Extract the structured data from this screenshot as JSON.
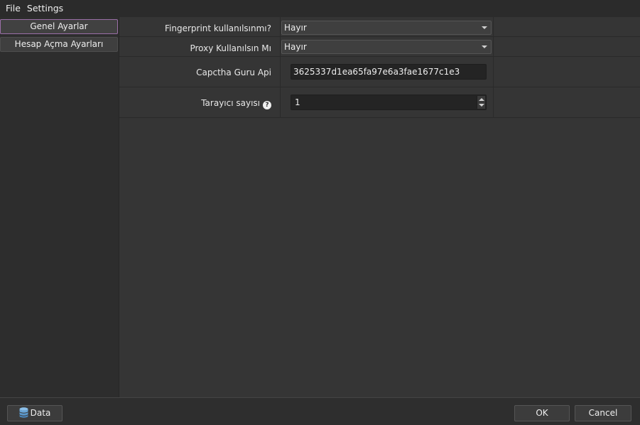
{
  "menubar": {
    "file": "File",
    "settings": "Settings"
  },
  "sidebar": {
    "items": [
      {
        "label": "Genel Ayarlar",
        "active": true
      },
      {
        "label": "Hesap Açma Ayarları",
        "active": false
      }
    ]
  },
  "settings": {
    "fingerprint": {
      "label": "Fingerprint kullanılsınmı?",
      "value": "Hayır"
    },
    "proxy": {
      "label": "Proxy Kullanılsın Mı",
      "value": "Hayır"
    },
    "captcha": {
      "label": "Capctha Guru Api",
      "value": "3625337d1ea65fa97e6a3fae1677c1e3"
    },
    "browsers": {
      "label": "Tarayıcı sayısı",
      "value": "1",
      "help_icon": "question-circle-icon"
    }
  },
  "footer": {
    "data_label": "Data",
    "data_icon": "database-icon",
    "ok_label": "OK",
    "cancel_label": "Cancel"
  },
  "colors": {
    "background": "#303030",
    "active_border": "#9a6fa7",
    "field_dark": "#242424",
    "db_icon": "#6aa6d8"
  }
}
